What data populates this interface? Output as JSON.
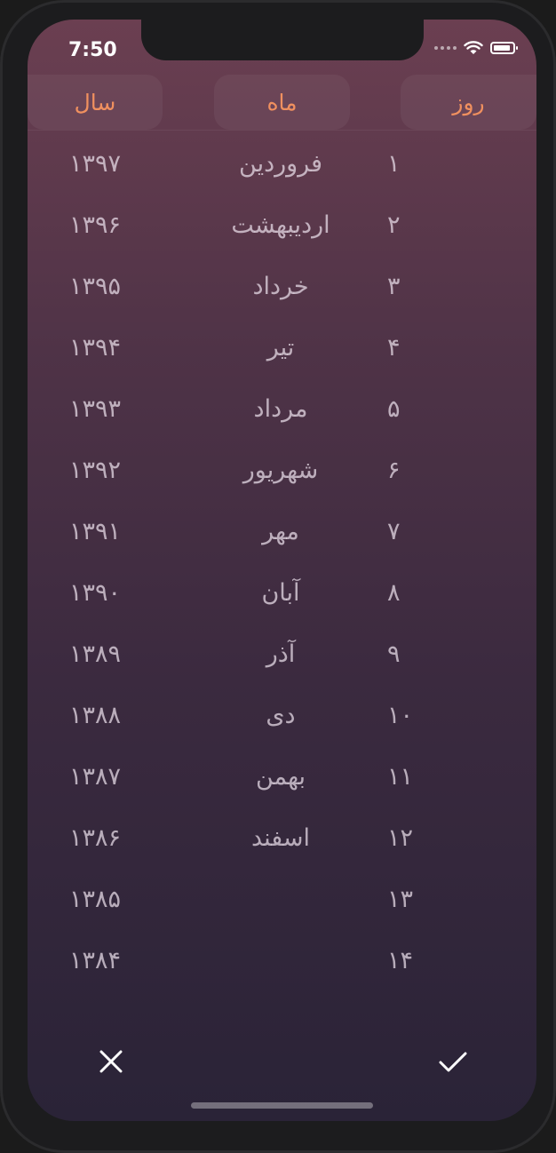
{
  "status_bar": {
    "time": "7:50"
  },
  "tabs": {
    "year": "سال",
    "month": "ماه",
    "day": "روز"
  },
  "colors": {
    "accent": "#f0905f",
    "text": "#e6dce6"
  },
  "years": [
    "۱۳۹۷",
    "۱۳۹۶",
    "۱۳۹۵",
    "۱۳۹۴",
    "۱۳۹۳",
    "۱۳۹۲",
    "۱۳۹۱",
    "۱۳۹۰",
    "۱۳۸۹",
    "۱۳۸۸",
    "۱۳۸۷",
    "۱۳۸۶",
    "۱۳۸۵",
    "۱۳۸۴"
  ],
  "months": [
    "فروردین",
    "اردیبهشت",
    "خرداد",
    "تیر",
    "مرداد",
    "شهریور",
    "مهر",
    "آبان",
    "آذر",
    "دی",
    "بهمن",
    "اسفند"
  ],
  "days": [
    "۱",
    "۲",
    "۳",
    "۴",
    "۵",
    "۶",
    "۷",
    "۸",
    "۹",
    "۱۰",
    "۱۱",
    "۱۲",
    "۱۳",
    "۱۴"
  ],
  "actions": {
    "cancel_icon": "close-icon",
    "confirm_icon": "checkmark-icon"
  }
}
